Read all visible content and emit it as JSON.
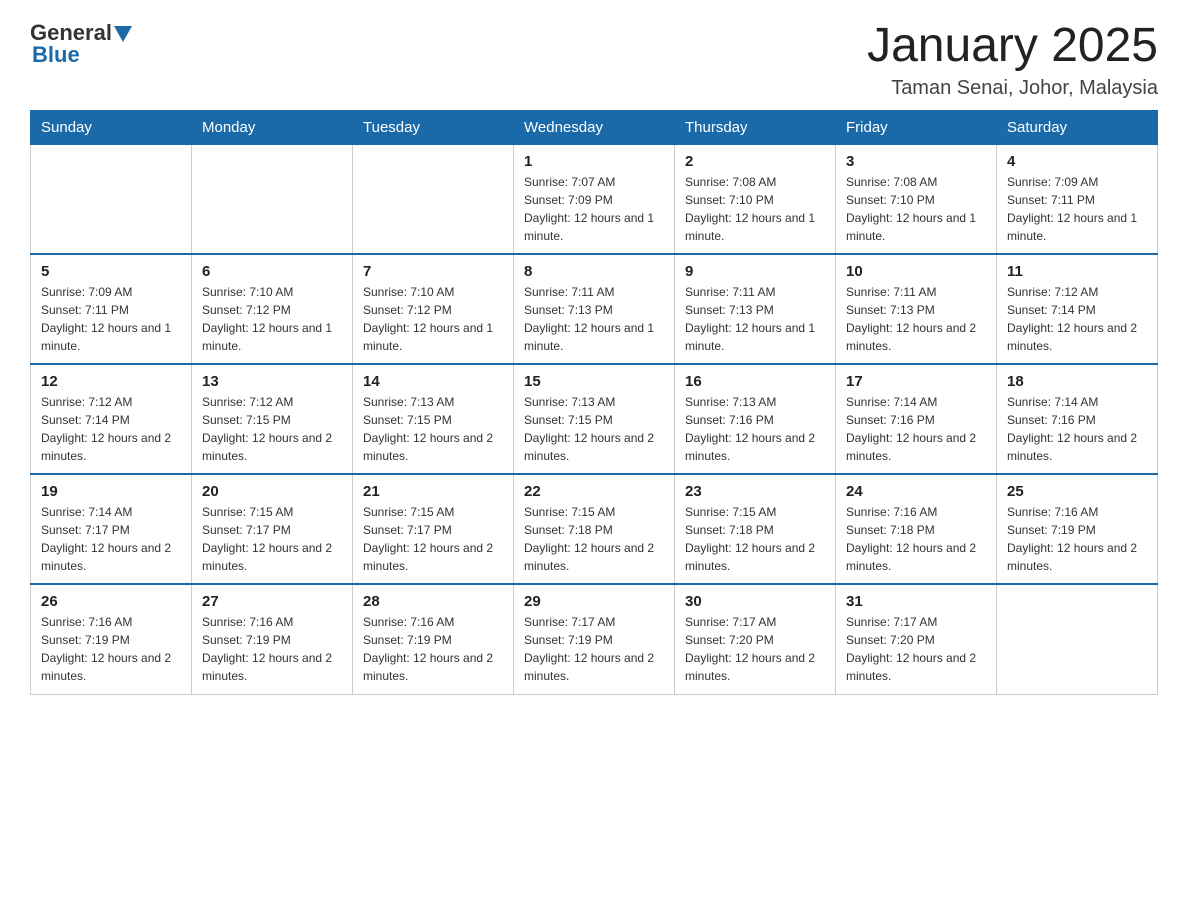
{
  "header": {
    "logo": {
      "general_text": "General",
      "blue_text": "Blue"
    },
    "title": "January 2025",
    "location": "Taman Senai, Johor, Malaysia"
  },
  "calendar": {
    "days_of_week": [
      "Sunday",
      "Monday",
      "Tuesday",
      "Wednesday",
      "Thursday",
      "Friday",
      "Saturday"
    ],
    "weeks": [
      [
        {
          "day": "",
          "info": ""
        },
        {
          "day": "",
          "info": ""
        },
        {
          "day": "",
          "info": ""
        },
        {
          "day": "1",
          "info": "Sunrise: 7:07 AM\nSunset: 7:09 PM\nDaylight: 12 hours and 1 minute."
        },
        {
          "day": "2",
          "info": "Sunrise: 7:08 AM\nSunset: 7:10 PM\nDaylight: 12 hours and 1 minute."
        },
        {
          "day": "3",
          "info": "Sunrise: 7:08 AM\nSunset: 7:10 PM\nDaylight: 12 hours and 1 minute."
        },
        {
          "day": "4",
          "info": "Sunrise: 7:09 AM\nSunset: 7:11 PM\nDaylight: 12 hours and 1 minute."
        }
      ],
      [
        {
          "day": "5",
          "info": "Sunrise: 7:09 AM\nSunset: 7:11 PM\nDaylight: 12 hours and 1 minute."
        },
        {
          "day": "6",
          "info": "Sunrise: 7:10 AM\nSunset: 7:12 PM\nDaylight: 12 hours and 1 minute."
        },
        {
          "day": "7",
          "info": "Sunrise: 7:10 AM\nSunset: 7:12 PM\nDaylight: 12 hours and 1 minute."
        },
        {
          "day": "8",
          "info": "Sunrise: 7:11 AM\nSunset: 7:13 PM\nDaylight: 12 hours and 1 minute."
        },
        {
          "day": "9",
          "info": "Sunrise: 7:11 AM\nSunset: 7:13 PM\nDaylight: 12 hours and 1 minute."
        },
        {
          "day": "10",
          "info": "Sunrise: 7:11 AM\nSunset: 7:13 PM\nDaylight: 12 hours and 2 minutes."
        },
        {
          "day": "11",
          "info": "Sunrise: 7:12 AM\nSunset: 7:14 PM\nDaylight: 12 hours and 2 minutes."
        }
      ],
      [
        {
          "day": "12",
          "info": "Sunrise: 7:12 AM\nSunset: 7:14 PM\nDaylight: 12 hours and 2 minutes."
        },
        {
          "day": "13",
          "info": "Sunrise: 7:12 AM\nSunset: 7:15 PM\nDaylight: 12 hours and 2 minutes."
        },
        {
          "day": "14",
          "info": "Sunrise: 7:13 AM\nSunset: 7:15 PM\nDaylight: 12 hours and 2 minutes."
        },
        {
          "day": "15",
          "info": "Sunrise: 7:13 AM\nSunset: 7:15 PM\nDaylight: 12 hours and 2 minutes."
        },
        {
          "day": "16",
          "info": "Sunrise: 7:13 AM\nSunset: 7:16 PM\nDaylight: 12 hours and 2 minutes."
        },
        {
          "day": "17",
          "info": "Sunrise: 7:14 AM\nSunset: 7:16 PM\nDaylight: 12 hours and 2 minutes."
        },
        {
          "day": "18",
          "info": "Sunrise: 7:14 AM\nSunset: 7:16 PM\nDaylight: 12 hours and 2 minutes."
        }
      ],
      [
        {
          "day": "19",
          "info": "Sunrise: 7:14 AM\nSunset: 7:17 PM\nDaylight: 12 hours and 2 minutes."
        },
        {
          "day": "20",
          "info": "Sunrise: 7:15 AM\nSunset: 7:17 PM\nDaylight: 12 hours and 2 minutes."
        },
        {
          "day": "21",
          "info": "Sunrise: 7:15 AM\nSunset: 7:17 PM\nDaylight: 12 hours and 2 minutes."
        },
        {
          "day": "22",
          "info": "Sunrise: 7:15 AM\nSunset: 7:18 PM\nDaylight: 12 hours and 2 minutes."
        },
        {
          "day": "23",
          "info": "Sunrise: 7:15 AM\nSunset: 7:18 PM\nDaylight: 12 hours and 2 minutes."
        },
        {
          "day": "24",
          "info": "Sunrise: 7:16 AM\nSunset: 7:18 PM\nDaylight: 12 hours and 2 minutes."
        },
        {
          "day": "25",
          "info": "Sunrise: 7:16 AM\nSunset: 7:19 PM\nDaylight: 12 hours and 2 minutes."
        }
      ],
      [
        {
          "day": "26",
          "info": "Sunrise: 7:16 AM\nSunset: 7:19 PM\nDaylight: 12 hours and 2 minutes."
        },
        {
          "day": "27",
          "info": "Sunrise: 7:16 AM\nSunset: 7:19 PM\nDaylight: 12 hours and 2 minutes."
        },
        {
          "day": "28",
          "info": "Sunrise: 7:16 AM\nSunset: 7:19 PM\nDaylight: 12 hours and 2 minutes."
        },
        {
          "day": "29",
          "info": "Sunrise: 7:17 AM\nSunset: 7:19 PM\nDaylight: 12 hours and 2 minutes."
        },
        {
          "day": "30",
          "info": "Sunrise: 7:17 AM\nSunset: 7:20 PM\nDaylight: 12 hours and 2 minutes."
        },
        {
          "day": "31",
          "info": "Sunrise: 7:17 AM\nSunset: 7:20 PM\nDaylight: 12 hours and 2 minutes."
        },
        {
          "day": "",
          "info": ""
        }
      ]
    ]
  }
}
